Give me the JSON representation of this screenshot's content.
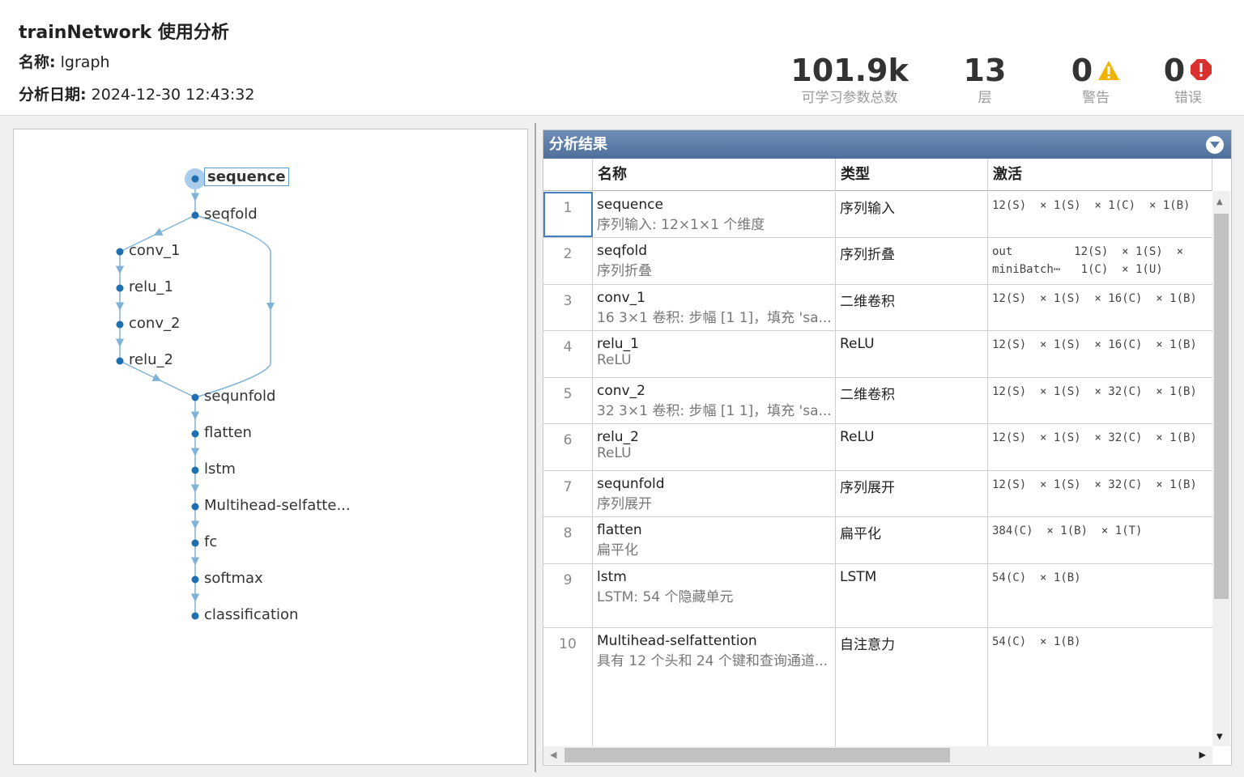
{
  "header": {
    "title": "trainNetwork 使用分析",
    "name_label": "名称:",
    "name_value": "lgraph",
    "date_label": "分析日期:",
    "date_value": "2024-12-30 12:43:32"
  },
  "stats": {
    "params": {
      "value": "101.9k",
      "label": "可学习参数总数"
    },
    "layers": {
      "value": "13",
      "label": "层"
    },
    "warnings": {
      "value": "0",
      "label": "警告",
      "icon": "warning-icon",
      "color": "#f0b400"
    },
    "errors": {
      "value": "0",
      "label": "错误",
      "icon": "error-icon",
      "color": "#d93030"
    }
  },
  "graph": {
    "nodes": [
      {
        "label": "sequence"
      },
      {
        "label": "seqfold"
      },
      {
        "label": "conv_1"
      },
      {
        "label": "relu_1"
      },
      {
        "label": "conv_2"
      },
      {
        "label": "relu_2"
      },
      {
        "label": "sequnfold"
      },
      {
        "label": "flatten"
      },
      {
        "label": "lstm"
      },
      {
        "label": "Multihead-selfatte..."
      },
      {
        "label": "fc"
      },
      {
        "label": "softmax"
      },
      {
        "label": "classification"
      }
    ],
    "edge_color": "#7fb2d6",
    "node_color": "#1f6fb0"
  },
  "results": {
    "title": "分析结果",
    "columns": [
      "名称",
      "类型",
      "激活"
    ],
    "rows": [
      {
        "idx": "1",
        "name": "sequence",
        "desc": "序列输入: 12×1×1 个维度",
        "type": "序列输入",
        "act": [
          "12(S)  × 1(S)  × 1(C)  × 1(B)"
        ]
      },
      {
        "idx": "2",
        "name": "seqfold",
        "desc": "序列折叠",
        "type": "序列折叠",
        "act": [
          "out         12(S)  × 1(S)  ×",
          "miniBatch⋯   1(C)  × 1(U)"
        ]
      },
      {
        "idx": "3",
        "name": "conv_1",
        "desc": "16 3×1 卷积: 步幅 [1 1]，填充 'sa...",
        "type": "二维卷积",
        "act": [
          "12(S)  × 1(S)  × 16(C)  × 1(B)"
        ]
      },
      {
        "idx": "4",
        "name": "relu_1",
        "desc": "ReLU",
        "type": "ReLU",
        "act": [
          "12(S)  × 1(S)  × 16(C)  × 1(B)"
        ]
      },
      {
        "idx": "5",
        "name": "conv_2",
        "desc": "32 3×1 卷积: 步幅 [1 1]，填充 'sa...",
        "type": "二维卷积",
        "act": [
          "12(S)  × 1(S)  × 32(C)  × 1(B)"
        ]
      },
      {
        "idx": "6",
        "name": "relu_2",
        "desc": "ReLU",
        "type": "ReLU",
        "act": [
          "12(S)  × 1(S)  × 32(C)  × 1(B)"
        ]
      },
      {
        "idx": "7",
        "name": "sequnfold",
        "desc": "序列展开",
        "type": "序列展开",
        "act": [
          "12(S)  × 1(S)  × 32(C)  × 1(B)"
        ]
      },
      {
        "idx": "8",
        "name": "flatten",
        "desc": "扁平化",
        "type": "扁平化",
        "act": [
          "384(C)  × 1(B)  × 1(T)"
        ]
      },
      {
        "idx": "9",
        "name": "lstm",
        "desc": "LSTM: 54 个隐藏单元",
        "type": "LSTM",
        "act": [
          "54(C)  × 1(B)"
        ]
      },
      {
        "idx": "10",
        "name": "Multihead-selfattention",
        "desc": "具有 12 个头和 24 个键和查询通道...",
        "type": "自注意力",
        "act": [
          "54(C)  × 1(B)"
        ]
      }
    ]
  }
}
